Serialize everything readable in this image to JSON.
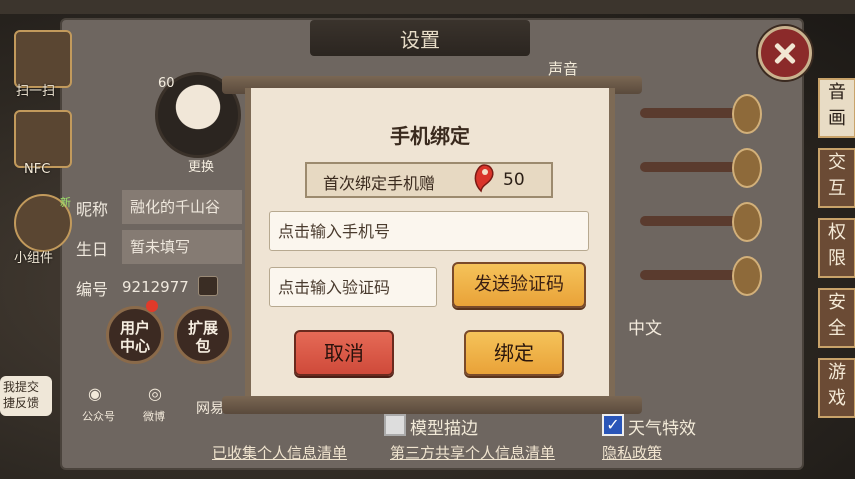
{
  "settings": {
    "title": "设置",
    "volume_label": "声音"
  },
  "sidebar_left": {
    "items": [
      {
        "label": "扫一扫"
      },
      {
        "label": "NFC"
      },
      {
        "label": "小组件"
      }
    ]
  },
  "profile": {
    "level": "60",
    "change_avatar": "更换",
    "new_badge": "新",
    "nickname_label": "昵称",
    "nickname_value": "融化的千山谷",
    "birthday_label": "生日",
    "birthday_value": "暂未填写",
    "id_label": "编号",
    "id_value": "9212977",
    "user_center": "用户\n中心",
    "expansion_pack": "扩展\n包",
    "wechat_label": "公众号",
    "weibo_label": "微博",
    "netease_label": "网易",
    "feedback": "我提交\n捷反馈"
  },
  "right_tabs": [
    {
      "label": "音\n画",
      "active": true
    },
    {
      "label": "交\n互",
      "active": false
    },
    {
      "label": "权\n限",
      "active": false
    },
    {
      "label": "安\n全",
      "active": false
    },
    {
      "label": "游\n戏",
      "active": false
    }
  ],
  "settings_right": {
    "language_value": "中文",
    "options": [
      {
        "label": "模型描边",
        "checked": false
      },
      {
        "label": "天气特效",
        "checked": true
      }
    ]
  },
  "bottom_links": [
    "已收集个人信息清单",
    "第三方共享个人信息清单",
    "隐私政策"
  ],
  "dialog": {
    "title": "手机绑定",
    "reward_text": "首次绑定手机赠",
    "reward_icon": "magatama-icon",
    "reward_amount": "50",
    "phone_placeholder": "点击输入手机号",
    "code_placeholder": "点击输入验证码",
    "send_code_label": "发送验证码",
    "cancel_label": "取消",
    "bind_label": "绑定"
  },
  "colors": {
    "dialog_bg": "#efe4d4",
    "confirm_btn": "#f0b64a",
    "cancel_btn": "#d95a48",
    "close_btn": "#8b2a2a"
  }
}
